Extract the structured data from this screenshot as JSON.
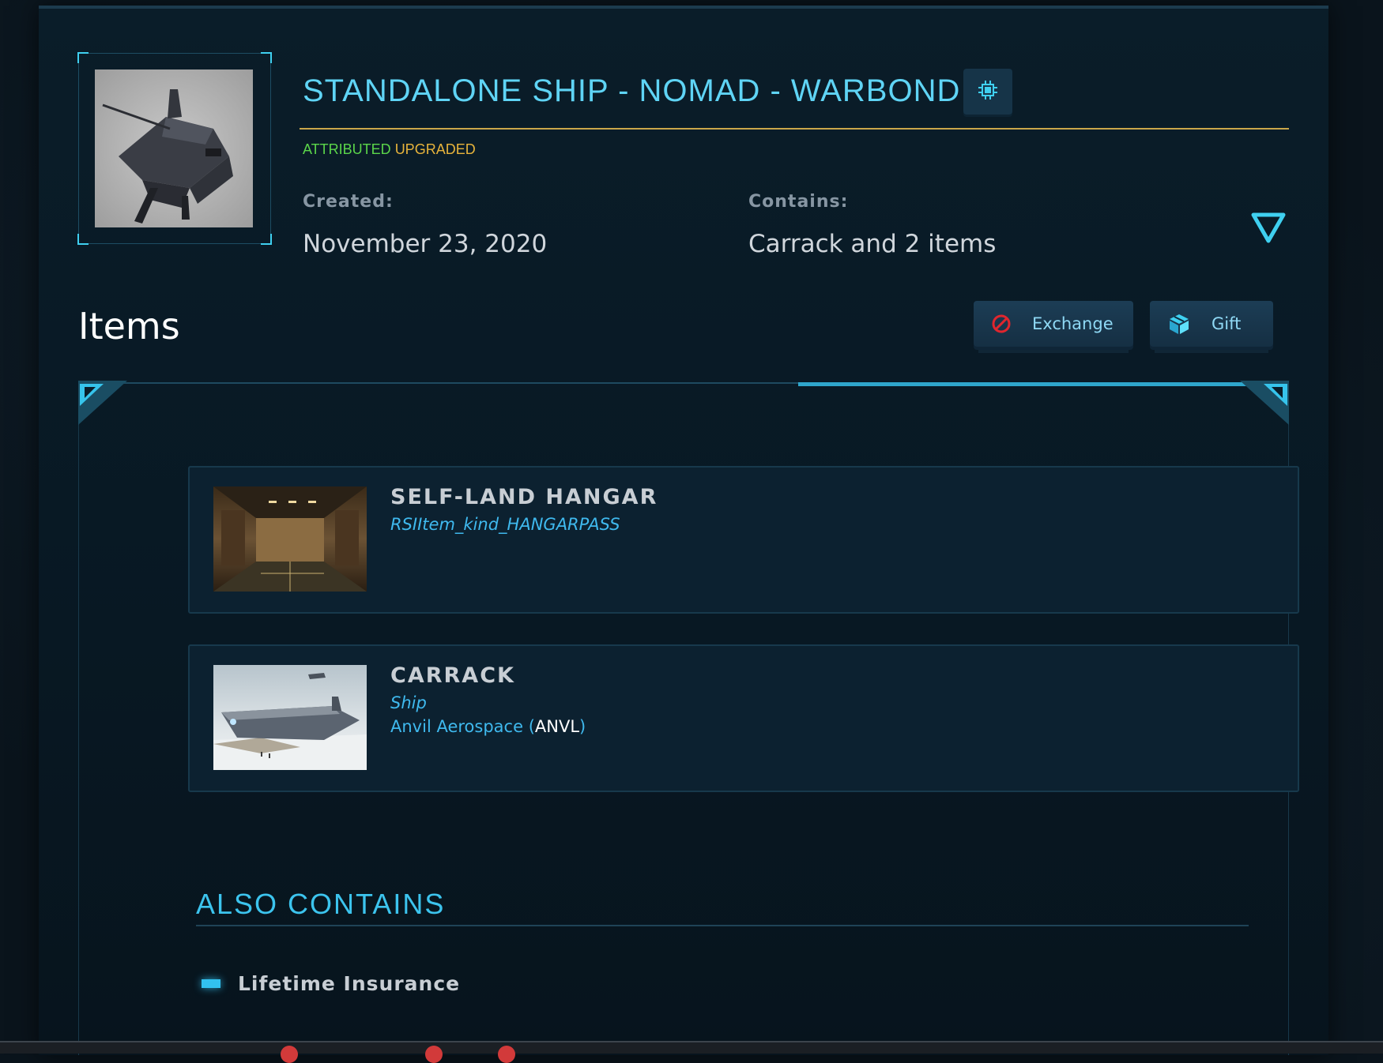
{
  "package": {
    "title": "STANDALONE SHIP - NOMAD - WARBOND",
    "tags": {
      "attributed": "ATTRIBUTED",
      "upgraded": "UPGRADED"
    },
    "created_label": "Created:",
    "created_value": "November 23, 2020",
    "contains_label": "Contains:",
    "contains_value": "Carrack and 2 items",
    "thumbnail_icon": "nomad-ship-image",
    "chip_icon": "chip-icon",
    "expand_icon": "triangle-down-icon"
  },
  "items_section": {
    "heading": "Items",
    "exchange_label": "Exchange",
    "gift_label": "Gift",
    "items": [
      {
        "name": "SELF-LAND HANGAR",
        "kind": "RSIItem_kind_HANGARPASS",
        "image": "hangar-image"
      },
      {
        "name": "CARRACK",
        "kind": "Ship",
        "maker": "Anvil Aerospace",
        "maker_open": "(",
        "maker_code": "ANVL",
        "maker_close": ")",
        "image": "carrack-image"
      }
    ]
  },
  "also_contains": {
    "heading": "ALSO CONTAINS",
    "items": [
      "Lifetime Insurance"
    ]
  },
  "colors": {
    "accent": "#5fd4f5",
    "attributed": "#5bd54a",
    "upgraded": "#e7b33b",
    "title_rule": "#caa64a"
  }
}
